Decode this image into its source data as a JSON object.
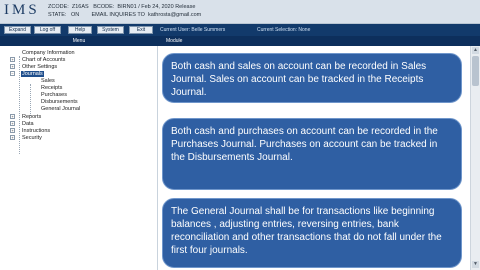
{
  "app": {
    "logo": "IMS"
  },
  "header": {
    "zcode_label": "ZCODE:",
    "zcode_value": "Z16AS",
    "state_label": "STATE:",
    "state_value": "ON",
    "bcode_label": "BCODE:",
    "bcode_value": "BIRN01 / Feb 24, 2020 Release",
    "email_label": "EMAIL INQUIRES TO",
    "email_value": "kathrosta@gmail.com"
  },
  "toolbar": {
    "buttons": [
      "Expand",
      "Log off",
      "Help",
      "System",
      "Exit"
    ],
    "current_user": "Current User: Belle Summers",
    "current_selection": "Current Selection: None"
  },
  "panels": {
    "menu_label": "Menu",
    "module_label": "Module"
  },
  "menu_tree": [
    {
      "label": "Company Information",
      "has_expander": false
    },
    {
      "label": "Chart of Accounts",
      "has_expander": true
    },
    {
      "label": "Other Settings",
      "has_expander": true
    },
    {
      "label": "Journals",
      "has_expander": true,
      "selected": true
    },
    {
      "label": "Sales",
      "child": true
    },
    {
      "label": "Receipts",
      "child": true
    },
    {
      "label": "Purchases",
      "child": true
    },
    {
      "label": "Disbursements",
      "child": true
    },
    {
      "label": "General Journal",
      "child": true
    },
    {
      "label": "Reports",
      "has_expander": true
    },
    {
      "label": "Data",
      "has_expander": true
    },
    {
      "label": "Instructions",
      "has_expander": true
    },
    {
      "label": "Security",
      "has_expander": true
    }
  ],
  "cards": [
    "Both cash and sales on account can be recorded in Sales Journal. Sales on account can be tracked in the Receipts Journal.",
    "Both cash and purchases on account can be recorded in the Purchases Journal. Purchases on account can be tracked in the Disbursements Journal.",
    "The General Journal shall be for transactions like beginning balances , adjusting entries, reversing entries, bank reconciliation and other transactions that do not fall under the first four journals."
  ],
  "colors": {
    "toolbar": "#123a6b",
    "panel_bar": "#0d2f5c",
    "card": "#2f5fa3",
    "selection": "#1f4e8c"
  }
}
